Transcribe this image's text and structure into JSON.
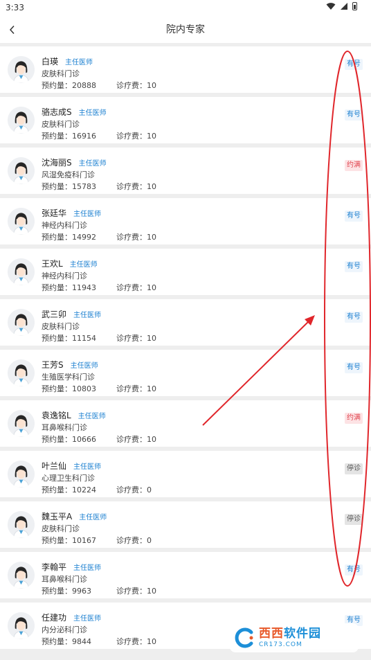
{
  "status_bar": {
    "time": "3:33"
  },
  "header": {
    "title": "院内专家"
  },
  "labels": {
    "booking_label": "预约量：",
    "fee_label": "诊疗费："
  },
  "doctors": [
    {
      "name": "白瑛",
      "title": "主任医师",
      "dept": "皮肤科门诊",
      "bookings": "20888",
      "fee": "10",
      "status": "有号",
      "status_type": "available"
    },
    {
      "name": "骆志成S",
      "title": "主任医师",
      "dept": "皮肤科门诊",
      "bookings": "16916",
      "fee": "10",
      "status": "有号",
      "status_type": "available"
    },
    {
      "name": "沈海丽S",
      "title": "主任医师",
      "dept": "风湿免疫科门诊",
      "bookings": "15783",
      "fee": "10",
      "status": "约满",
      "status_type": "full"
    },
    {
      "name": "张廷华",
      "title": "主任医师",
      "dept": "神经内科门诊",
      "bookings": "14992",
      "fee": "10",
      "status": "有号",
      "status_type": "available"
    },
    {
      "name": "王欢L",
      "title": "主任医师",
      "dept": "神经内科门诊",
      "bookings": "11943",
      "fee": "10",
      "status": "有号",
      "status_type": "available"
    },
    {
      "name": "武三卯",
      "title": "主任医师",
      "dept": "皮肤科门诊",
      "bookings": "11154",
      "fee": "10",
      "status": "有号",
      "status_type": "available"
    },
    {
      "name": "王芳S",
      "title": "主任医师",
      "dept": "生殖医学科门诊",
      "bookings": "10803",
      "fee": "10",
      "status": "有号",
      "status_type": "available"
    },
    {
      "name": "袁逸铭L",
      "title": "主任医师",
      "dept": "耳鼻喉科门诊",
      "bookings": "10666",
      "fee": "10",
      "status": "约满",
      "status_type": "full"
    },
    {
      "name": "叶兰仙",
      "title": "主任医师",
      "dept": "心理卫生科门诊",
      "bookings": "10224",
      "fee": "0",
      "status": "停诊",
      "status_type": "stopped"
    },
    {
      "name": "魏玉平A",
      "title": "主任医师",
      "dept": "皮肤科门诊",
      "bookings": "10167",
      "fee": "0",
      "status": "停诊",
      "status_type": "stopped"
    },
    {
      "name": "李翰平",
      "title": "主任医师",
      "dept": "耳鼻喉科门诊",
      "bookings": "9963",
      "fee": "10",
      "status": "有号",
      "status_type": "available"
    },
    {
      "name": "任建功",
      "title": "主任医师",
      "dept": "内分泌科门诊",
      "bookings": "9844",
      "fee": "10",
      "status": "有号",
      "status_type": "available"
    }
  ],
  "colors": {
    "accent_blue": "#1a7fd0",
    "full_red": "#e0454f",
    "stopped_gray": "#555555",
    "annotation_red": "#e0262b"
  },
  "icons": {
    "back": "chevron-left-icon",
    "avatar": "doctor-avatar-icon"
  },
  "watermark": {
    "main_a": "西西",
    "main_b": "软件园",
    "sub": "CR173.COM"
  }
}
